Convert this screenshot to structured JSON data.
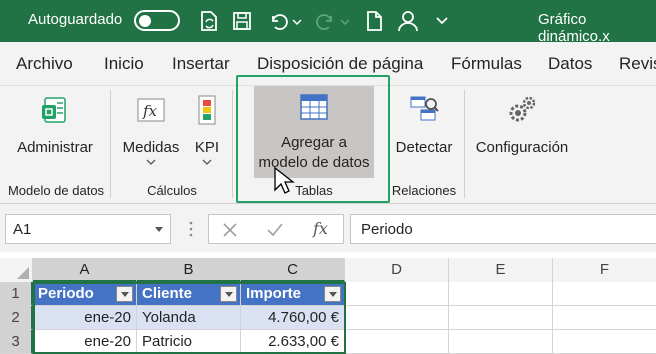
{
  "titlebar": {
    "autosave_label": "Autoguardado",
    "file_title": "Gráfico dinámico.x"
  },
  "tabs": [
    "Archivo",
    "Inicio",
    "Insertar",
    "Disposición de página",
    "Fórmulas",
    "Datos",
    "Revis"
  ],
  "ribbon": {
    "administrar": "Administrar",
    "medidas": "Medidas",
    "kpi": "KPI",
    "agregar_line1": "Agregar a",
    "agregar_line2": "modelo de datos",
    "detectar": "Detectar",
    "configuracion": "Configuración",
    "groups": {
      "modelo": "Modelo de datos",
      "calculos": "Cálculos",
      "tablas": "Tablas",
      "relaciones": "Relaciones"
    }
  },
  "formula_bar": {
    "name_box": "A1",
    "fx": "fx",
    "value": "Periodo"
  },
  "columns": [
    "A",
    "B",
    "C",
    "D",
    "E",
    "F"
  ],
  "rows": [
    "1",
    "2",
    "3"
  ],
  "table": {
    "headers": [
      "Periodo",
      "Cliente",
      "Importe"
    ],
    "rows": [
      [
        "ene-20",
        "Yolanda",
        "4.760,00 €"
      ],
      [
        "ene-20",
        "Patricio",
        "2.633,00 €"
      ]
    ]
  },
  "colors": {
    "excel_green": "#217346",
    "table_header": "#4472c4",
    "band": "#d9e1f2",
    "highlight": "#21a366"
  }
}
